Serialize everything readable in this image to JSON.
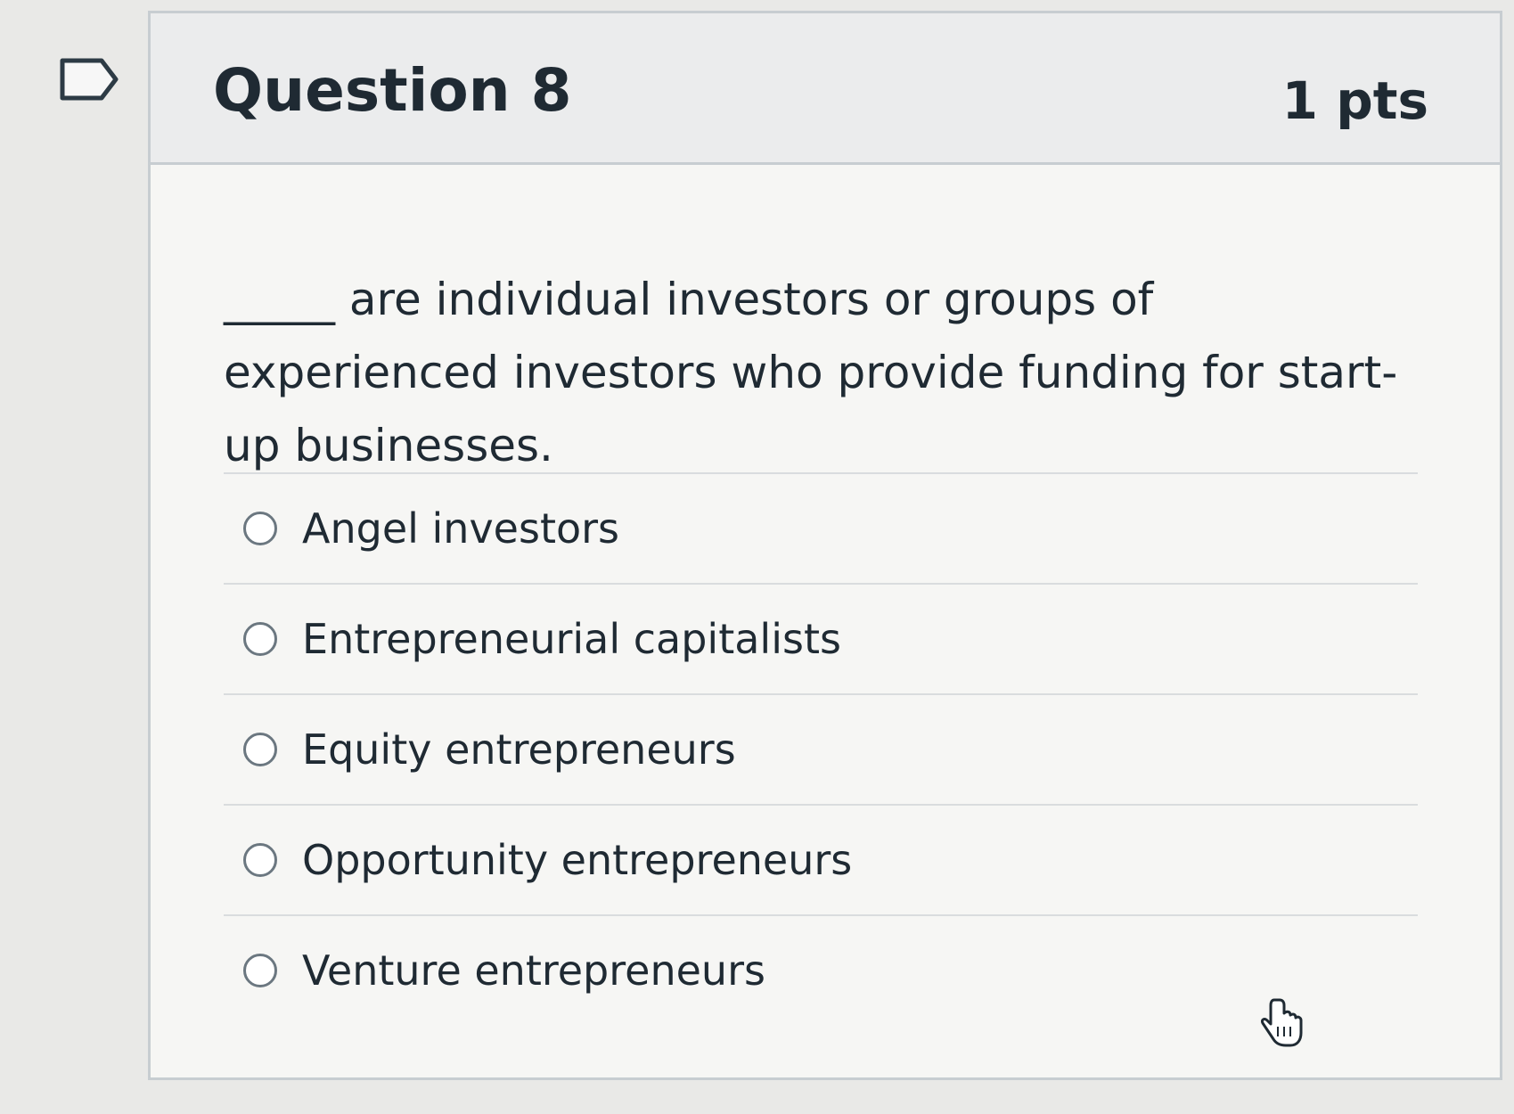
{
  "question": {
    "title": "Question 8",
    "points": "1 pts",
    "text": "_____ are individual investors or groups of experienced investors who provide funding for start-up businesses."
  },
  "answers": [
    {
      "label": "Angel investors",
      "selected": false
    },
    {
      "label": "Entrepreneurial capitalists",
      "selected": false
    },
    {
      "label": "Equity entrepreneurs",
      "selected": false
    },
    {
      "label": "Opportunity entrepreneurs",
      "selected": false
    },
    {
      "label": "Venture entrepreneurs",
      "selected": false
    }
  ],
  "icons": {
    "flag": "flag-question-icon",
    "cursor": "hand-pointer-cursor-icon"
  }
}
